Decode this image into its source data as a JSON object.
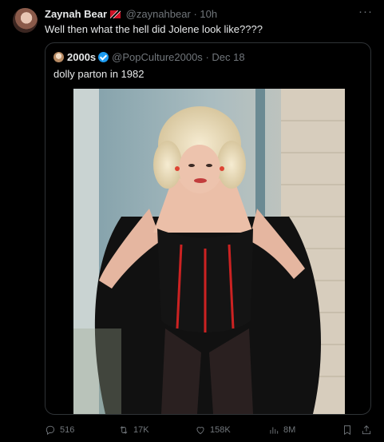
{
  "tweet": {
    "author_name": "Zaynah Bear",
    "handle": "@zaynahbear",
    "separator": "·",
    "time": "10h",
    "text": "Well then what the hell did Jolene look like????",
    "more_label": "···"
  },
  "quoted": {
    "author_name": "2000s",
    "handle": "@PopCulture2000s",
    "separator": "·",
    "date": "Dec 18",
    "text": "dolly parton in 1982"
  },
  "actions": {
    "replies": "516",
    "reposts": "17K",
    "likes": "158K",
    "views": "8M"
  },
  "icons": [
    "more-icon",
    "verified-icon",
    "flag-icon",
    "reply-icon",
    "repost-icon",
    "like-icon",
    "views-icon",
    "bookmark-icon",
    "share-icon"
  ],
  "colors": {
    "background": "#000000",
    "text": "#e7e9ea",
    "muted": "#71767b",
    "verified": "#1d9bf0",
    "border": "#2f3336"
  }
}
